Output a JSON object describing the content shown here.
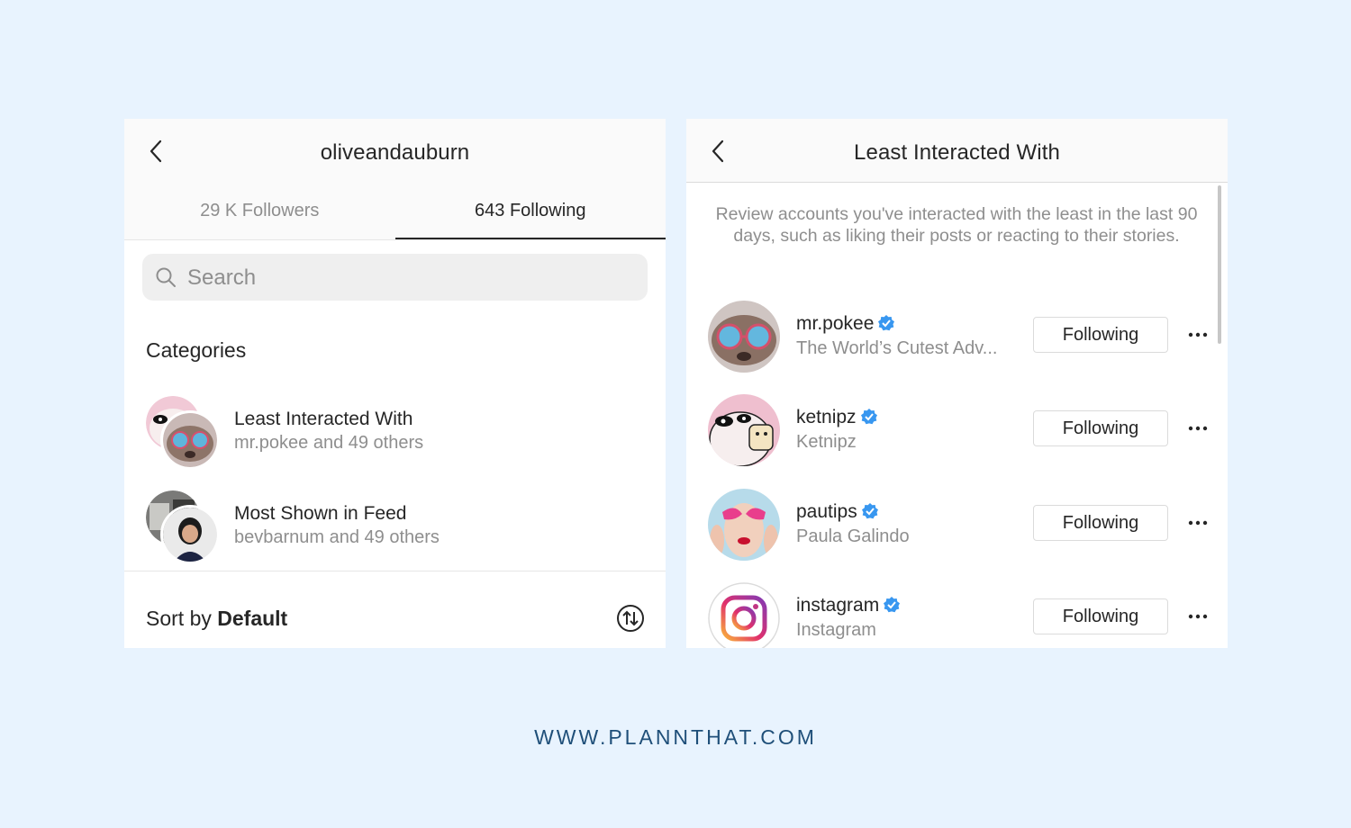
{
  "left_panel": {
    "title": "oliveandauburn",
    "tabs": [
      {
        "label": "29 K Followers"
      },
      {
        "label": "643 Following",
        "active": true
      }
    ],
    "search": {
      "placeholder": "Search"
    },
    "categories_title": "Categories",
    "categories": [
      {
        "title": "Least Interacted With",
        "subtitle": "mr.pokee and 49 others"
      },
      {
        "title": "Most Shown in Feed",
        "subtitle": "bevbarnum and 49 others"
      }
    ],
    "sort": {
      "prefix": "Sort by ",
      "value": "Default"
    }
  },
  "right_panel": {
    "title": "Least Interacted With",
    "description": "Review accounts you've interacted with the least in the last 90 days, such as liking their posts or reacting to their stories.",
    "accounts": [
      {
        "username": "mr.pokee",
        "verified": true,
        "name": "The World’s Cutest Adv...",
        "button": "Following"
      },
      {
        "username": "ketnipz",
        "verified": true,
        "name": "Ketnipz",
        "button": "Following"
      },
      {
        "username": "pautips",
        "verified": true,
        "name": "Paula Galindo",
        "button": "Following"
      },
      {
        "username": "instagram",
        "verified": true,
        "name": "Instagram",
        "button": "Following"
      }
    ]
  },
  "footer": {
    "text": "WWW.PLANNTHAT.COM"
  },
  "colors": {
    "background": "#e8f3fe",
    "verified": "#3897f0",
    "footer": "#1f4f79"
  }
}
